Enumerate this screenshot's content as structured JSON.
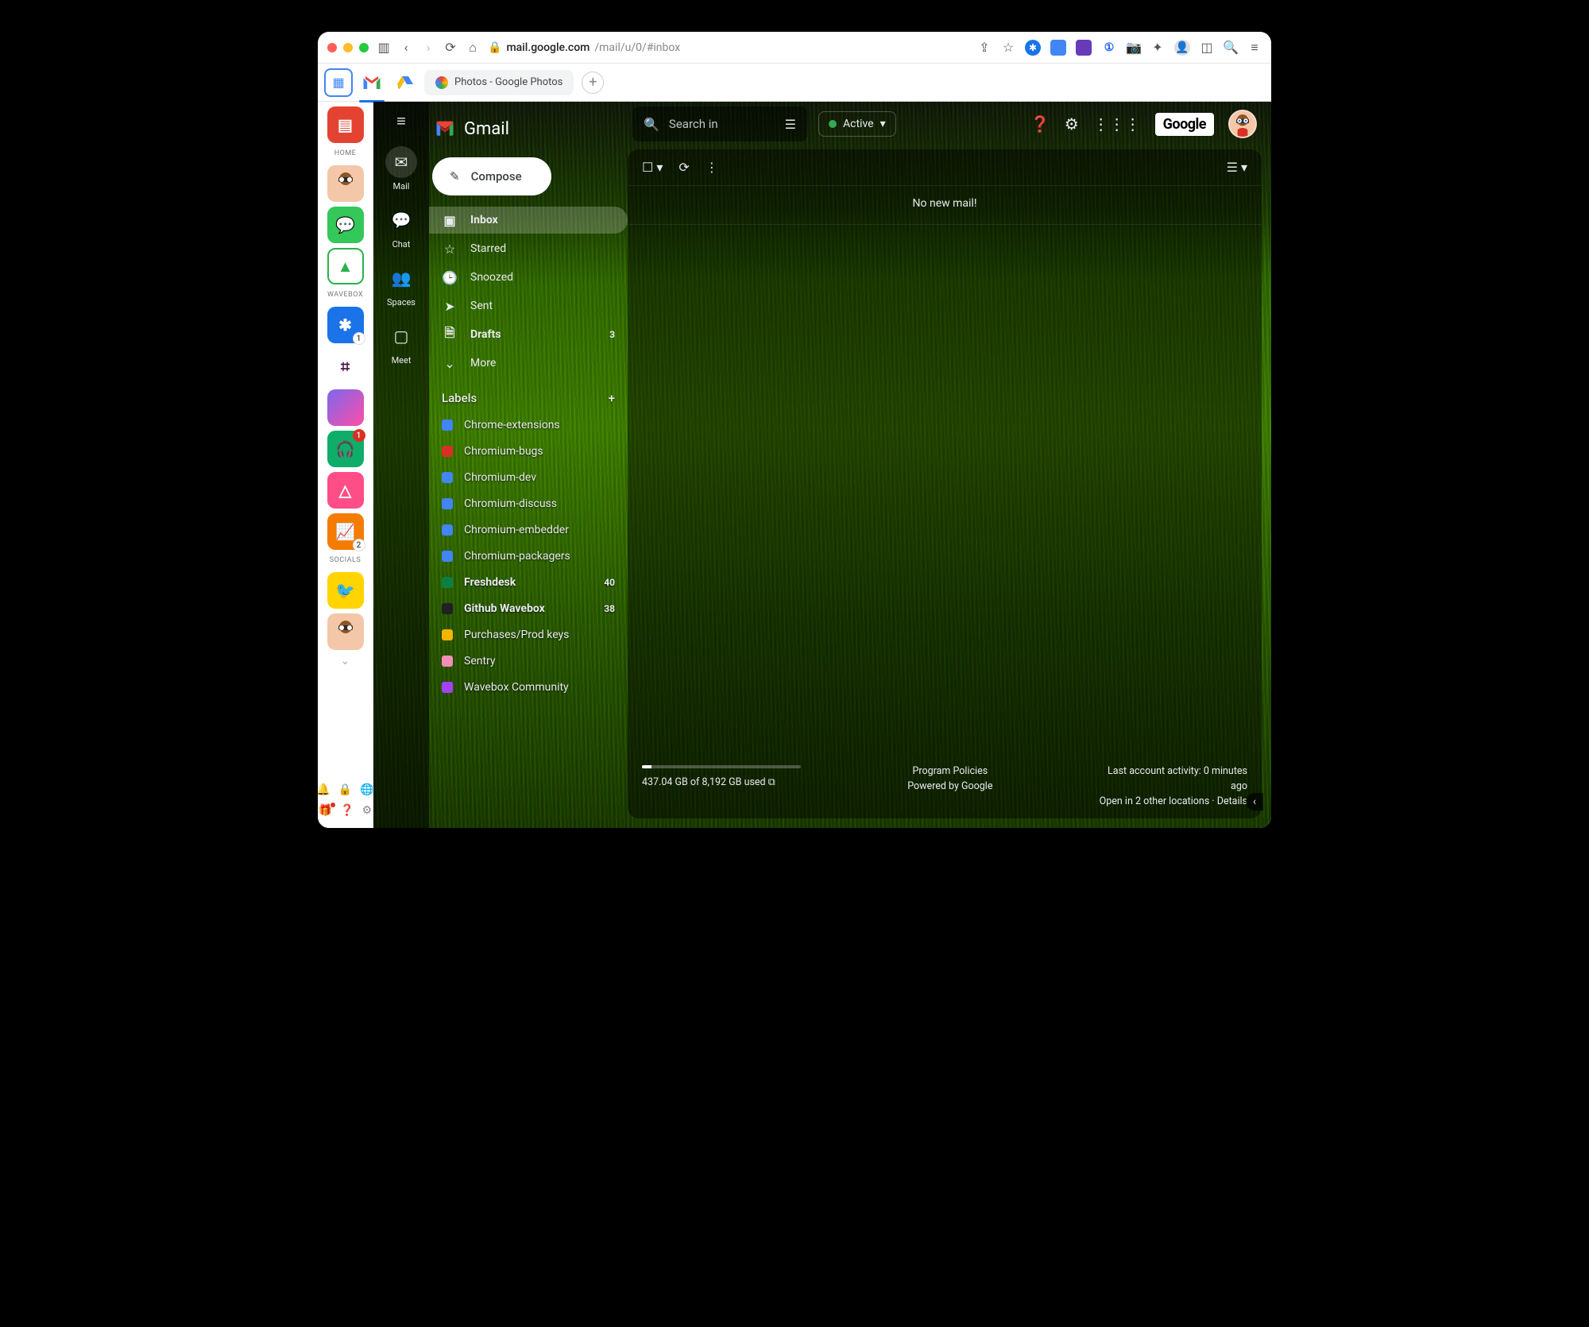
{
  "titlebar": {
    "url_domain": "mail.google.com",
    "url_path": "/mail/u/0/#inbox"
  },
  "tabstrip": {
    "browser_tab_label": "Photos - Google Photos"
  },
  "wavebox": {
    "section_home": "HOME",
    "section_wavebox": "WAVEBOX",
    "section_socials": "SOCIALS",
    "badge_1": "1",
    "badge_2": "2",
    "badge_red1": "1"
  },
  "gmail": {
    "brand": "Gmail",
    "mini": {
      "mail": "Mail",
      "chat": "Chat",
      "spaces": "Spaces",
      "meet": "Meet"
    },
    "compose": "Compose",
    "folders": {
      "inbox": "Inbox",
      "starred": "Starred",
      "snoozed": "Snoozed",
      "sent": "Sent",
      "drafts": "Drafts",
      "drafts_count": "3",
      "more": "More"
    },
    "labels_header": "Labels",
    "labels": [
      {
        "name": "Chrome-extensions",
        "color": "#4285f4"
      },
      {
        "name": "Chromium-bugs",
        "color": "#d93025"
      },
      {
        "name": "Chromium-dev",
        "color": "#4285f4"
      },
      {
        "name": "Chromium-discuss",
        "color": "#4285f4"
      },
      {
        "name": "Chromium-embedder",
        "color": "#4285f4"
      },
      {
        "name": "Chromium-packagers",
        "color": "#4285f4"
      },
      {
        "name": "Freshdesk",
        "color": "#0b8043",
        "count": "40",
        "bold": true
      },
      {
        "name": "Github Wavebox",
        "color": "#202124",
        "count": "38",
        "bold": true
      },
      {
        "name": "Purchases/Prod keys",
        "color": "#f4b400"
      },
      {
        "name": "Sentry",
        "color": "#f38eb8"
      },
      {
        "name": "Wavebox Community",
        "color": "#a142f4"
      }
    ],
    "search_placeholder": "Search in",
    "status": "Active",
    "google_chip": "Google",
    "no_mail": "No new mail!",
    "footer": {
      "storage_text": "437.04 GB of 8,192 GB used",
      "policies": "Program Policies",
      "powered": "Powered by Google",
      "activity_line1": "Last account activity: 0 minutes",
      "activity_line2": "ago",
      "activity_line3": "Open in 2 other locations · Details"
    }
  }
}
